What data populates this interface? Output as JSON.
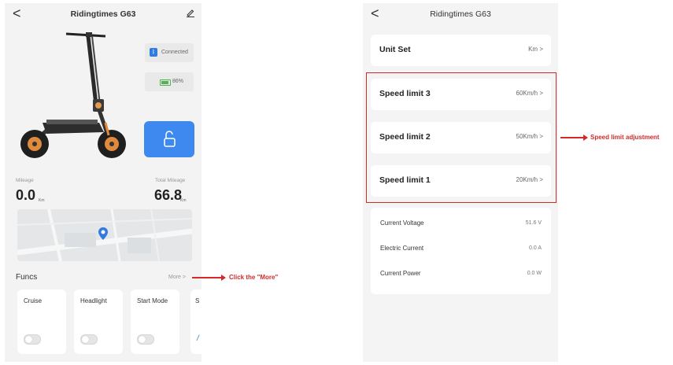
{
  "left_screen": {
    "title": "Ridingtimes G63",
    "back_glyph": "<",
    "status": {
      "connected_label": "Connected",
      "battery_label": "86%",
      "battery_level_percent": 86
    },
    "mileage": {
      "label": "Mileage",
      "value": "0.0",
      "unit": "Km"
    },
    "total_mileage": {
      "label": "Total Mileage",
      "value": "66.8",
      "unit": "Km"
    },
    "funcs": {
      "title": "Funcs",
      "more_label": "More >",
      "cards": [
        {
          "label": "Cruise",
          "enabled": false
        },
        {
          "label": "Headlight",
          "enabled": false
        },
        {
          "label": "Start Mode",
          "enabled": false
        },
        {
          "label": "S"
        }
      ]
    },
    "icons": {
      "back": "back-arrow-icon",
      "edit": "edit-pencil-icon",
      "bluetooth": "bluetooth-icon",
      "battery": "battery-icon",
      "lock": "unlock-icon",
      "map_pin": "location-pin-icon"
    }
  },
  "annotations": {
    "more": "Click the \"More\"",
    "speed": "Speed limit adjustment",
    "color": "#d42a2a"
  },
  "right_screen": {
    "title": "Ridingtimes G63",
    "back_glyph": "<",
    "rows": [
      {
        "label": "Unit Set",
        "value": "Km >"
      },
      {
        "label": "Speed limit 3",
        "value": "60Km/h >"
      },
      {
        "label": "Speed limit 2",
        "value": "50Km/h >"
      },
      {
        "label": "Speed limit 1",
        "value": "20Km/h >"
      }
    ],
    "info": [
      {
        "label": "Current Voltage",
        "value": "51.6 V"
      },
      {
        "label": "Electric Current",
        "value": "0.0 A"
      },
      {
        "label": "Current Power",
        "value": "0.0 W"
      }
    ]
  },
  "colors": {
    "accent_blue": "#3d89f0",
    "annotation_red": "#d42a2a",
    "battery_green": "#4fb34f"
  }
}
